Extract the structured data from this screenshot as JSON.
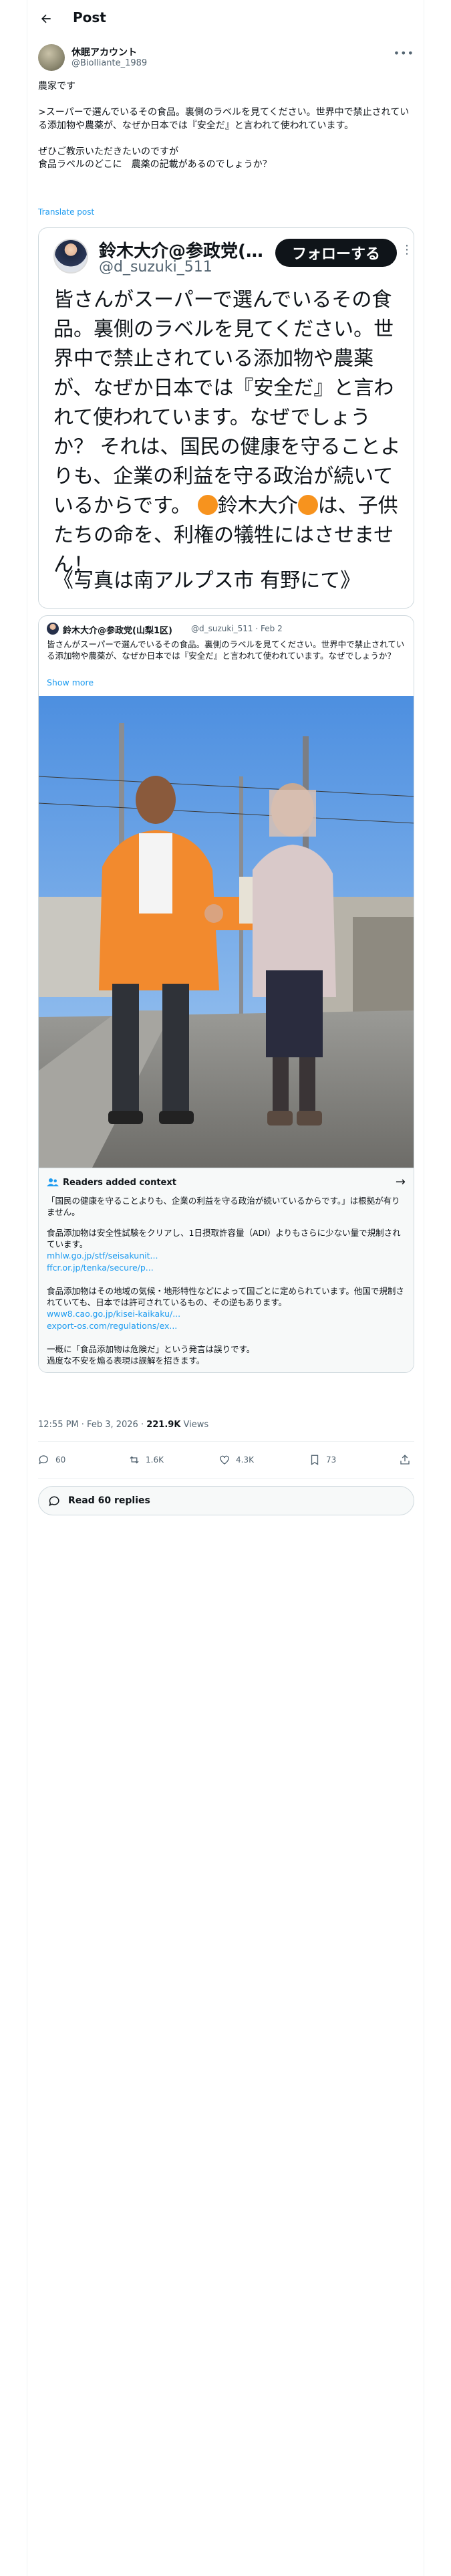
{
  "header": {
    "back_icon": "arrow-left-icon",
    "title": "Post"
  },
  "author": {
    "name": "休眠アカウント",
    "handle": "@Biolliante_1989",
    "more_icon": "more-horizontal-icon"
  },
  "post": {
    "text": "農家です\n\n>スーパーで選んでいるその食品。裏側のラベルを見てください。世界中で禁止されている添加物や農薬が、なぜか日本では『安全だ』と言われて使われています。\n\nぜひご教示いただきたいのですが\n食品ラベルのどこに　農薬の記載があるのでしょうか？",
    "translate": "Translate post"
  },
  "quoted_image": {
    "name": "鈴木大介@参政党(…",
    "handle": "@d_suzuki_511",
    "follow_label": "フォローする",
    "text_part1": "皆さんがスーパーで選んでいるその食品。裏側のラベルを見てください。世界中で禁止されている添加物や農薬が、なぜか日本では『安全だ』と言われて使われています。なぜでしょうか？ それは、国民の健康を守ることよりも、企業の利益を守る政治が続いているからです。",
    "text_part2": "鈴木大介",
    "text_part3": "は、子供たちの命を、利権の犠牲にはさせません！",
    "caption": "《写真は南アルプス市 有野にて》"
  },
  "quoted_post": {
    "name": "鈴木大介@参政党(山梨1区)",
    "handle": "@d_suzuki_511 · Feb 2",
    "text": "皆さんがスーパーで選んでいるその食品。裏側のラベルを見てください。世界中で禁止されている添加物や農薬が、なぜか日本では『安全だ』と言われて使われています。なぜでしょうか？",
    "show_more": "Show more"
  },
  "note": {
    "title": "Readers added context",
    "p1": "「国民の健康を守ることよりも、企業の利益を守る政治が続いているからです。」は根拠が有りません。",
    "p2": "食品添加物は安全性試験をクリアし、1日摂取許容量（ADI）よりもさらに少ない量で規制されています。",
    "link1": "mhlw.go.jp/stf/seisakunit...",
    "link2": "ffcr.or.jp/tenka/secure/p...",
    "p3": "食品添加物はその地域の気候・地形特性などによって国ごとに定められています。他国で規制されていても、日本では許可されているもの、その逆もあります。",
    "link3": "www8.cao.go.jp/kisei-kaikaku/...",
    "link4": "export-os.com/regulations/ex...",
    "p4": "一概に「食品添加物は危険だ」という発言は誤りです。\n過度な不安を煽る表現は誤解を招きます。"
  },
  "meta": {
    "time": "12:55 PM · Feb 3, 2026 · ",
    "views": "221.9K",
    "views_label": " Views"
  },
  "actions": {
    "replies": "60",
    "reposts": "1.6K",
    "likes": "4.3K",
    "bookmarks": "73"
  },
  "read_replies": "Read 60 replies",
  "colors": {
    "accent": "#1d9bf0",
    "text": "#0f1419",
    "muted": "#536471",
    "jacket": "#f28a2e"
  }
}
